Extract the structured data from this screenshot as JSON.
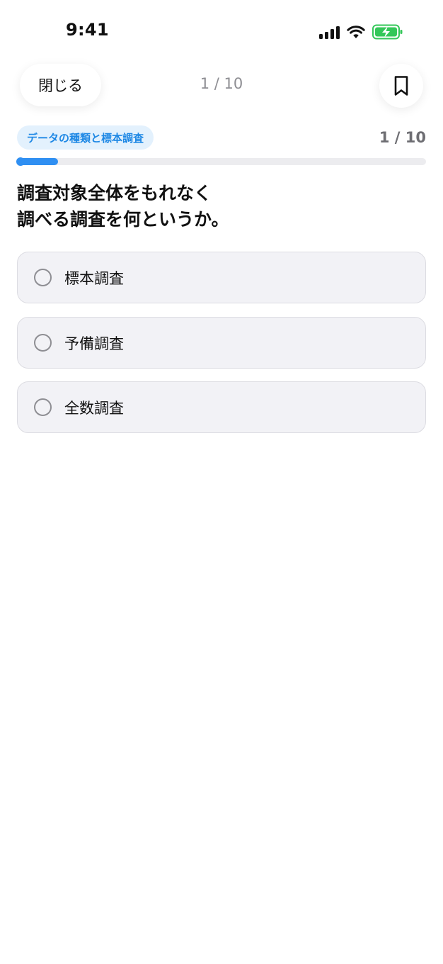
{
  "status_bar": {
    "time": "9:41",
    "icons": [
      "cellular-signal-icon",
      "wifi-icon",
      "battery-charging-icon"
    ],
    "battery_color": "#34c759"
  },
  "header": {
    "close_label": "閉じる",
    "counter": "1 / 10",
    "bookmark_icon": "bookmark-icon"
  },
  "quiz": {
    "category": "データの種類と標本調査",
    "progress_label": "1 / 10",
    "progress_fraction": 0.1,
    "question_line1": "調査対象全体をもれなく",
    "question_line2": "調べる調査を何というか。",
    "options": [
      {
        "label": "標本調査"
      },
      {
        "label": "予備調査"
      },
      {
        "label": "全数調査"
      }
    ]
  },
  "colors": {
    "accent": "#2f8ff2",
    "chip_bg": "#e3f1fd",
    "chip_text": "#1e88e5",
    "option_bg": "#f2f2f6"
  }
}
